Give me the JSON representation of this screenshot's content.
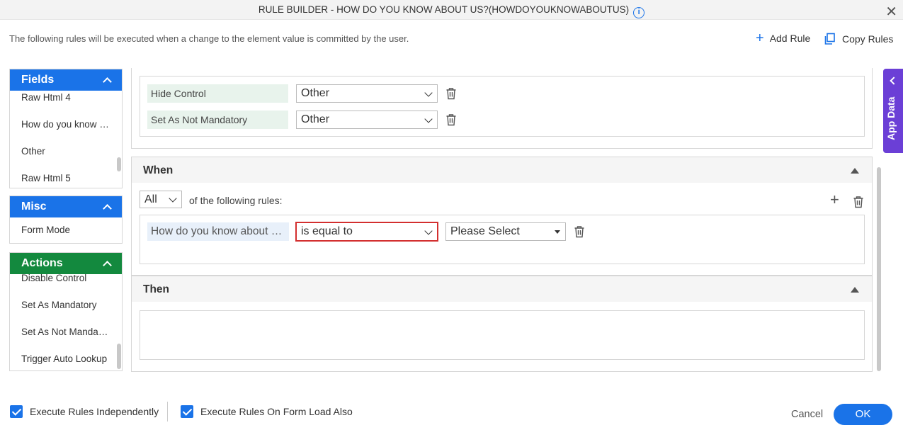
{
  "dialog": {
    "title": "RULE BUILDER - HOW DO YOU KNOW ABOUT US?(HOWDOYOUKNOWABOUTUS)",
    "description": "The following rules will be executed when a change to the element value is committed by the user.",
    "add_rule": "Add Rule",
    "copy_rules": "Copy Rules",
    "app_data": "App Data"
  },
  "fields": {
    "header": "Fields",
    "items": [
      "Raw Html 4",
      "How do you know about us?",
      "Other",
      "Raw Html 5"
    ]
  },
  "misc": {
    "header": "Misc",
    "items": [
      "Form Mode"
    ]
  },
  "actions": {
    "header": "Actions",
    "items": [
      "Disable Control",
      "Set As Mandatory",
      "Set As Not Mandatory",
      "Trigger Auto Lookup"
    ]
  },
  "top_actions": [
    {
      "label": "Hide Control",
      "value": "Other"
    },
    {
      "label": "Set As Not Mandatory",
      "value": "Other"
    }
  ],
  "when": {
    "header": "When",
    "match": "All",
    "match_text": "of the following rules:",
    "condition": {
      "field": "How do you know about us?",
      "operator": "is equal to",
      "value": "Please Select"
    }
  },
  "then": {
    "header": "Then"
  },
  "footer": {
    "execute_independently": "Execute Rules Independently",
    "execute_on_load": "Execute Rules On Form Load Also",
    "cancel": "Cancel",
    "ok": "OK"
  },
  "colors": {
    "accent": "#1a73e8",
    "actions_header": "#13893e",
    "app_data": "#6b3fd6",
    "error_border": "#d32f2f"
  }
}
